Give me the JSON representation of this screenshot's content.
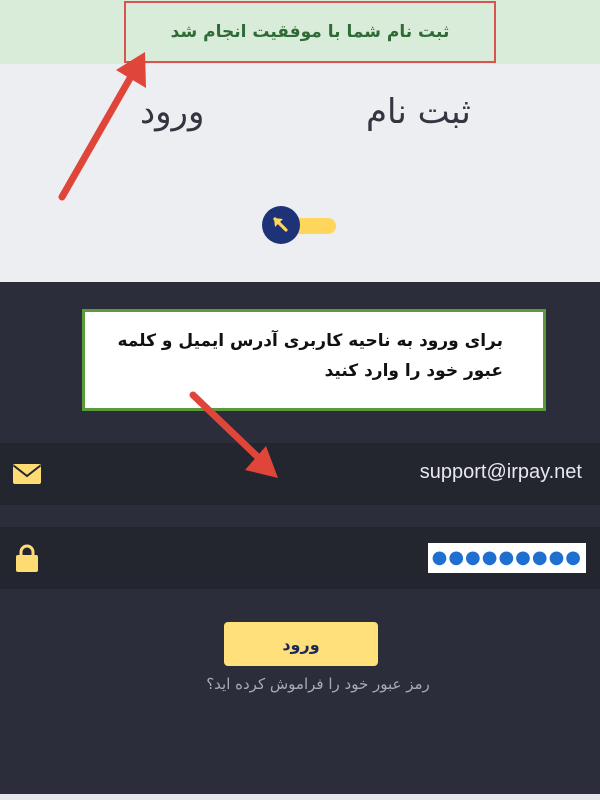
{
  "alert": {
    "success_message": "ثبت نام شما با موفقیت انجام شد"
  },
  "tabs": {
    "login_label": "ورود",
    "register_label": "ثبت نام"
  },
  "toggle": {
    "icon": "arrow-up-left-icon",
    "track_color": "#ffd65c",
    "knob_color": "#1e3277"
  },
  "annotation": {
    "hint_line1": "برای ورود به ناحیه کاربری آدرس ایمیل و کلمه",
    "hint_line2": "عبور خود را وارد کنید"
  },
  "form": {
    "email_icon": "envelope-icon",
    "email_value": "support@irpay.net",
    "password_icon": "lock-icon",
    "password_value": "●●●●●●●●●",
    "login_button_label": "ورود",
    "forgot_password_label": "رمز عبور خود را فراموش کرده اید؟"
  },
  "colors": {
    "accent_yellow": "#ffe07a",
    "dark_background": "#2b2d3a",
    "success_background": "#d9ecd9",
    "annotation_red": "#e0453a"
  }
}
